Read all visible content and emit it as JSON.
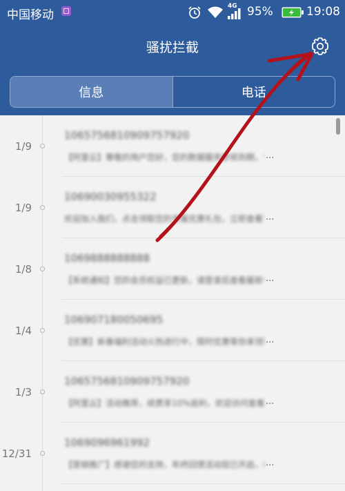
{
  "status_bar": {
    "carrier": "中国移动",
    "network": "4G",
    "battery": "95%",
    "time": "19:08"
  },
  "header": {
    "title": "骚扰拦截",
    "tabs": [
      {
        "label": "信息",
        "active": true
      },
      {
        "label": "电话",
        "active": false
      }
    ]
  },
  "messages": [
    {
      "date": "1/9",
      "sender": "1065756810909757920",
      "preview": "【阿里云】尊敬的用户您好，您的数据服务即将到期，请尽快续费",
      "ellipsis": "..."
    },
    {
      "date": "1/9",
      "sender": "10690030955322",
      "preview": "欢迎加入我们，点击领取您的专属优惠礼包，立即查看详情",
      "ellipsis": "..."
    },
    {
      "date": "1/8",
      "sender": "1069888888888",
      "preview": "【系统通知】您的会员权益已更新，请登录后查看最新信息",
      "ellipsis": "..."
    },
    {
      "date": "1/4",
      "sender": "106907180050695",
      "preview": "【优惠】新春福利活动火热进行中，限时优惠等你来领取哦",
      "ellipsis": "..."
    },
    {
      "date": "1/3",
      "sender": "1065756810909757920",
      "preview": "【阿里云】活动推荐，续费享10%返利，欢迎访问查看详情",
      "ellipsis": "..."
    },
    {
      "date": "12/31",
      "sender": "1069096961992",
      "preview": "【营销推广】感谢您的支持，年终回馈活动现已开启，敬请关注",
      "ellipsis": "..."
    }
  ],
  "colors": {
    "header": "#2d5b9b",
    "active_tab": "#5a7eb6",
    "annotation": "#b4121b"
  },
  "icons": [
    "sim-icon",
    "alarm-icon",
    "wifi-icon",
    "signal-icon",
    "battery-icon",
    "gear-icon"
  ]
}
